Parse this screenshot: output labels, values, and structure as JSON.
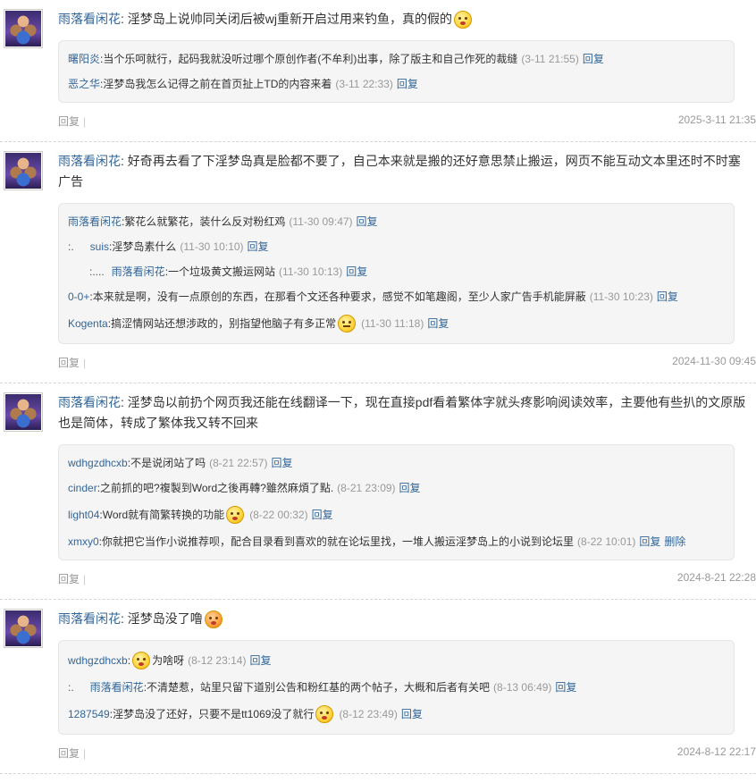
{
  "posts": [
    {
      "author": "雨落看闲花",
      "text": "淫梦岛上说帅同关闭后被wj重新开启过用来钓鱼，真的假的",
      "emoji": "confused-face-icon",
      "replies": [
        {
          "indent": "",
          "who": "曙阳炎",
          "text": "当个乐呵就行，起码我就没听过哪个原创作者(不牟利)出事，除了版主和自己作死的裁缝",
          "time": "(3-11 21:55)",
          "reply": "回复"
        },
        {
          "indent": "",
          "who": "恶之华",
          "text": "淫梦岛我怎么记得之前在首页扯上TD的内容来着",
          "time": "(3-11 22:33)",
          "reply": "回复"
        }
      ],
      "foot_reply": "回复",
      "foot_sep": "|",
      "date": "2025-3-11 21:35"
    },
    {
      "author": "雨落看闲花",
      "text": "好奇再去看了下淫梦岛真是脸都不要了，自己本来就是搬的还好意思禁止搬运，网页不能互动文本里还时不时塞广告",
      "replies": [
        {
          "indent": "",
          "who": "雨落看闲花",
          "text": "繁花么就繁花，装什么反对粉红鸡",
          "time": "(11-30 09:47)",
          "reply": "回复"
        },
        {
          "indent": ":.",
          "who": "suis",
          "text": "淫梦岛素什么",
          "time": "(11-30 10:10)",
          "reply": "回复"
        },
        {
          "indent": ":....",
          "who": "雨落看闲花",
          "text": "一个垃圾黄文搬运网站",
          "time": "(11-30 10:13)",
          "reply": "回复"
        },
        {
          "indent": "",
          "who": "0-0+",
          "text": "本来就是啊，没有一点原创的东西，在那看个文还各种要求，感觉不如笔趣阁，至少人家广告手机能屏蔽",
          "time": "(11-30 10:23)",
          "reply": "回复"
        },
        {
          "indent": "",
          "who": "Kogenta",
          "text": "搞涩情网站还想涉政的，别指望他脑子有多正常",
          "emoji": "expressionless-face-icon",
          "time": "(11-30 11:18)",
          "reply": "回复"
        }
      ],
      "foot_reply": "回复",
      "foot_sep": "|",
      "date": "2024-11-30 09:45"
    },
    {
      "author": "雨落看闲花",
      "text": "淫梦岛以前扔个网页我还能在线翻译一下，现在直接pdf看着繁体字就头疼影响阅读效率，主要他有些扒的文原版也是简体，转成了繁体我又转不回来",
      "replies": [
        {
          "indent": "",
          "who": "wdhgzdhcxb",
          "text": "不是说闭站了吗",
          "time": "(8-21 22:57)",
          "reply": "回复"
        },
        {
          "indent": "",
          "who": "cinder",
          "text": "之前抓的吧?複製到Word之後再轉?雖然麻煩了點.",
          "time": "(8-21 23:09)",
          "reply": "回复"
        },
        {
          "indent": "",
          "who": "light04",
          "text": "Word就有简繁转换的功能",
          "emoji": "confused-face-icon",
          "time": "(8-22 00:32)",
          "reply": "回复"
        },
        {
          "indent": "",
          "who": "xmxy0",
          "text": "你就把它当作小说推荐呗，配合目录看到喜欢的就在论坛里找，一堆人搬运淫梦岛上的小说到论坛里",
          "time": "(8-22 10:01)",
          "reply": "回复",
          "del": "删除"
        }
      ],
      "foot_reply": "回复",
      "foot_sep": "|",
      "date": "2024-8-21 22:28"
    },
    {
      "author": "雨落看闲花",
      "text": "淫梦岛没了噜",
      "emoji": "annoyed-face-icon",
      "replies": [
        {
          "indent": "",
          "who": "wdhgzdhcxb",
          "pre_emoji": "confused-face-icon",
          "text": "为啥呀",
          "time": "(8-12 23:14)",
          "reply": "回复"
        },
        {
          "indent": ":.",
          "who": "雨落看闲花",
          "text": "不清楚惹，站里只留下道别公告和粉红基的两个帖子，大概和后者有关吧",
          "time": "(8-13 06:49)",
          "reply": "回复"
        },
        {
          "indent": "",
          "who": "1287549",
          "text": "淫梦岛没了还好，只要不是tt1069没了就行",
          "emoji": "confused-face-icon",
          "time": "(8-12 23:49)",
          "reply": "回复"
        }
      ],
      "foot_reply": "回复",
      "foot_sep": "|",
      "date": "2024-8-12 22:17"
    }
  ]
}
